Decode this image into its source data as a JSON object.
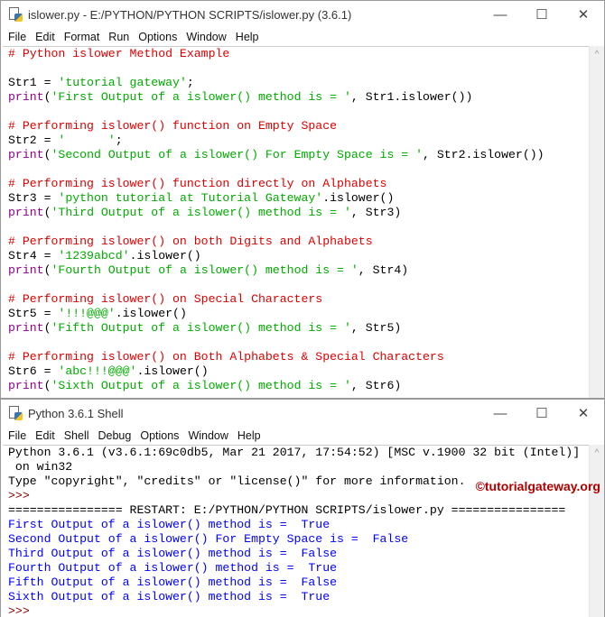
{
  "editor": {
    "title": "islower.py - E:/PYTHON/PYTHON SCRIPTS/islower.py (3.6.1)",
    "menu": [
      "File",
      "Edit",
      "Format",
      "Run",
      "Options",
      "Window",
      "Help"
    ],
    "lines": [
      [
        [
          "# Python islower Method Example",
          "cm"
        ]
      ],
      [],
      [
        [
          "Str1 = ",
          "df"
        ],
        [
          "'tutorial gateway'",
          "st"
        ],
        [
          ";",
          "df"
        ]
      ],
      [
        [
          "print",
          "kw"
        ],
        [
          "(",
          "df"
        ],
        [
          "'First Output of a islower() method is = '",
          "st"
        ],
        [
          ", Str1.islower())",
          "df"
        ]
      ],
      [],
      [
        [
          "# Performing islower() function on Empty Space",
          "cm"
        ]
      ],
      [
        [
          "Str2 = ",
          "df"
        ],
        [
          "'      '",
          "st"
        ],
        [
          ";",
          "df"
        ]
      ],
      [
        [
          "print",
          "kw"
        ],
        [
          "(",
          "df"
        ],
        [
          "'Second Output of a islower() For Empty Space is = '",
          "st"
        ],
        [
          ", Str2.islower())",
          "df"
        ]
      ],
      [],
      [
        [
          "# Performing islower() function directly on Alphabets",
          "cm"
        ]
      ],
      [
        [
          "Str3 = ",
          "df"
        ],
        [
          "'python tutorial at Tutorial Gateway'",
          "st"
        ],
        [
          ".islower()",
          "df"
        ]
      ],
      [
        [
          "print",
          "kw"
        ],
        [
          "(",
          "df"
        ],
        [
          "'Third Output of a islower() method is = '",
          "st"
        ],
        [
          ", Str3)",
          "df"
        ]
      ],
      [],
      [
        [
          "# Performing islower() on both Digits and Alphabets",
          "cm"
        ]
      ],
      [
        [
          "Str4 = ",
          "df"
        ],
        [
          "'1239abcd'",
          "st"
        ],
        [
          ".islower()",
          "df"
        ]
      ],
      [
        [
          "print",
          "kw"
        ],
        [
          "(",
          "df"
        ],
        [
          "'Fourth Output of a islower() method is = '",
          "st"
        ],
        [
          ", Str4)",
          "df"
        ]
      ],
      [],
      [
        [
          "# Performing islower() on Special Characters",
          "cm"
        ]
      ],
      [
        [
          "Str5 = ",
          "df"
        ],
        [
          "'!!!@@@'",
          "st"
        ],
        [
          ".islower()",
          "df"
        ]
      ],
      [
        [
          "print",
          "kw"
        ],
        [
          "(",
          "df"
        ],
        [
          "'Fifth Output of a islower() method is = '",
          "st"
        ],
        [
          ", Str5)",
          "df"
        ]
      ],
      [],
      [
        [
          "# Performing islower() on Both Alphabets & Special Characters",
          "cm"
        ]
      ],
      [
        [
          "Str6 = ",
          "df"
        ],
        [
          "'abc!!!@@@'",
          "st"
        ],
        [
          ".islower()",
          "df"
        ]
      ],
      [
        [
          "print",
          "kw"
        ],
        [
          "(",
          "df"
        ],
        [
          "'Sixth Output of a islower() method is = '",
          "st"
        ],
        [
          ", Str6)",
          "df"
        ]
      ]
    ]
  },
  "shell": {
    "title": "Python 3.6.1 Shell",
    "menu": [
      "File",
      "Edit",
      "Shell",
      "Debug",
      "Options",
      "Window",
      "Help"
    ],
    "watermark": "©tutorialgateway.org",
    "lines": [
      [
        [
          "Python 3.6.1 (v3.6.1:69c0db5, Mar 21 2017, 17:54:52) [MSC v.1900 32 bit (Intel)]",
          "df"
        ]
      ],
      [
        [
          " on win32",
          "df"
        ]
      ],
      [
        [
          "Type \"copyright\", \"credits\" or \"license()\" for more information.",
          "df"
        ]
      ],
      [
        [
          ">>>",
          "pr"
        ]
      ],
      [
        [
          "================ RESTART: E:/PYTHON/PYTHON SCRIPTS/islower.py ================",
          "df"
        ]
      ],
      [
        [
          "First Output of a islower() method is =  True",
          "ou"
        ]
      ],
      [
        [
          "Second Output of a islower() For Empty Space is =  False",
          "ou"
        ]
      ],
      [
        [
          "Third Output of a islower() method is =  False",
          "ou"
        ]
      ],
      [
        [
          "Fourth Output of a islower() method is =  True",
          "ou"
        ]
      ],
      [
        [
          "Fifth Output of a islower() method is =  False",
          "ou"
        ]
      ],
      [
        [
          "Sixth Output of a islower() method is =  True",
          "ou"
        ]
      ],
      [
        [
          ">>> ",
          "pr"
        ]
      ]
    ]
  },
  "controls": {
    "minimize": "—",
    "maximize": "☐",
    "close": "✕",
    "scroll_up": "^"
  }
}
